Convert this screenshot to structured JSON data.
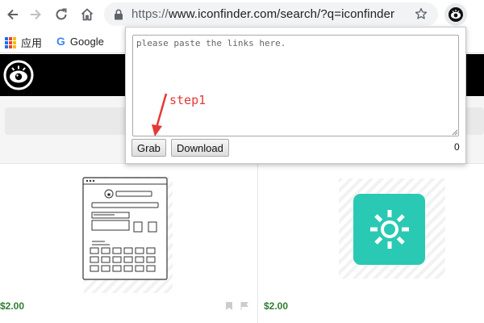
{
  "browser": {
    "url_scheme": "https://",
    "url_rest": "www.iconfinder.com/search/?q=iconfinder",
    "nav": [
      "back",
      "forward",
      "reload",
      "home"
    ]
  },
  "bookmarks": [
    {
      "label": "应用",
      "icon": "apps-grid-icon"
    },
    {
      "label": "Google",
      "icon": "google-icon"
    }
  ],
  "popup": {
    "placeholder": "please paste the links here.",
    "grab_label": "Grab",
    "download_label": "Download",
    "count": "0"
  },
  "annotation": {
    "text": "step1",
    "color": "#e53935"
  },
  "results": [
    {
      "price": "$2.00"
    },
    {
      "price": "$2.00"
    }
  ],
  "colors": {
    "header": "#000000",
    "teal": "#2ac9b3",
    "price": "#2e7d32"
  }
}
